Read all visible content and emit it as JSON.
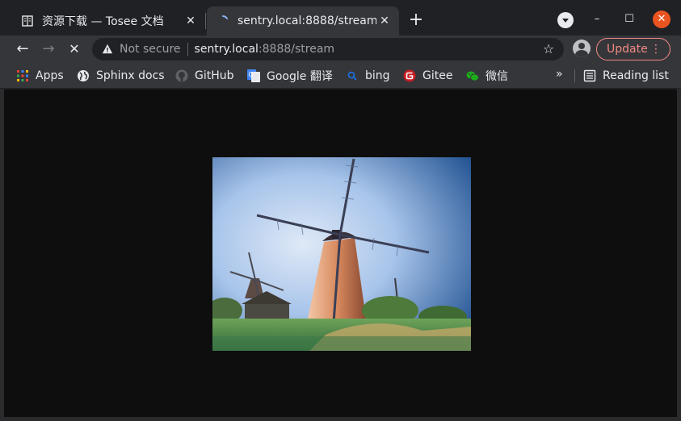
{
  "tabs": [
    {
      "title": "资源下载 — Tosee 文档",
      "icon": "document-icon",
      "active": false
    },
    {
      "title": "sentry.local:8888/stream",
      "icon": "loading-spinner-icon",
      "active": true
    }
  ],
  "toolbar": {
    "security_label": "Not secure",
    "url_host": "sentry.local",
    "url_rest": ":8888/stream",
    "update_label": "Update"
  },
  "bookmarks": [
    {
      "label": "Apps",
      "icon": "apps-grid-icon"
    },
    {
      "label": "Sphinx docs",
      "icon": "globe-icon"
    },
    {
      "label": "GitHub",
      "icon": "github-icon"
    },
    {
      "label": "Google 翻译",
      "icon": "google-translate-icon"
    },
    {
      "label": "bing",
      "icon": "search-icon"
    },
    {
      "label": "Gitee",
      "icon": "gitee-icon"
    },
    {
      "label": "微信",
      "icon": "wechat-icon"
    }
  ],
  "bookmarks_more": "»",
  "reading_list": {
    "label": "Reading list",
    "icon": "reading-list-icon"
  },
  "stream": {
    "description_icon": "video-stream-image"
  },
  "colors": {
    "accent_update": "#f28b82",
    "close_button": "#e95420",
    "content_bg": "#0e0e0e"
  }
}
